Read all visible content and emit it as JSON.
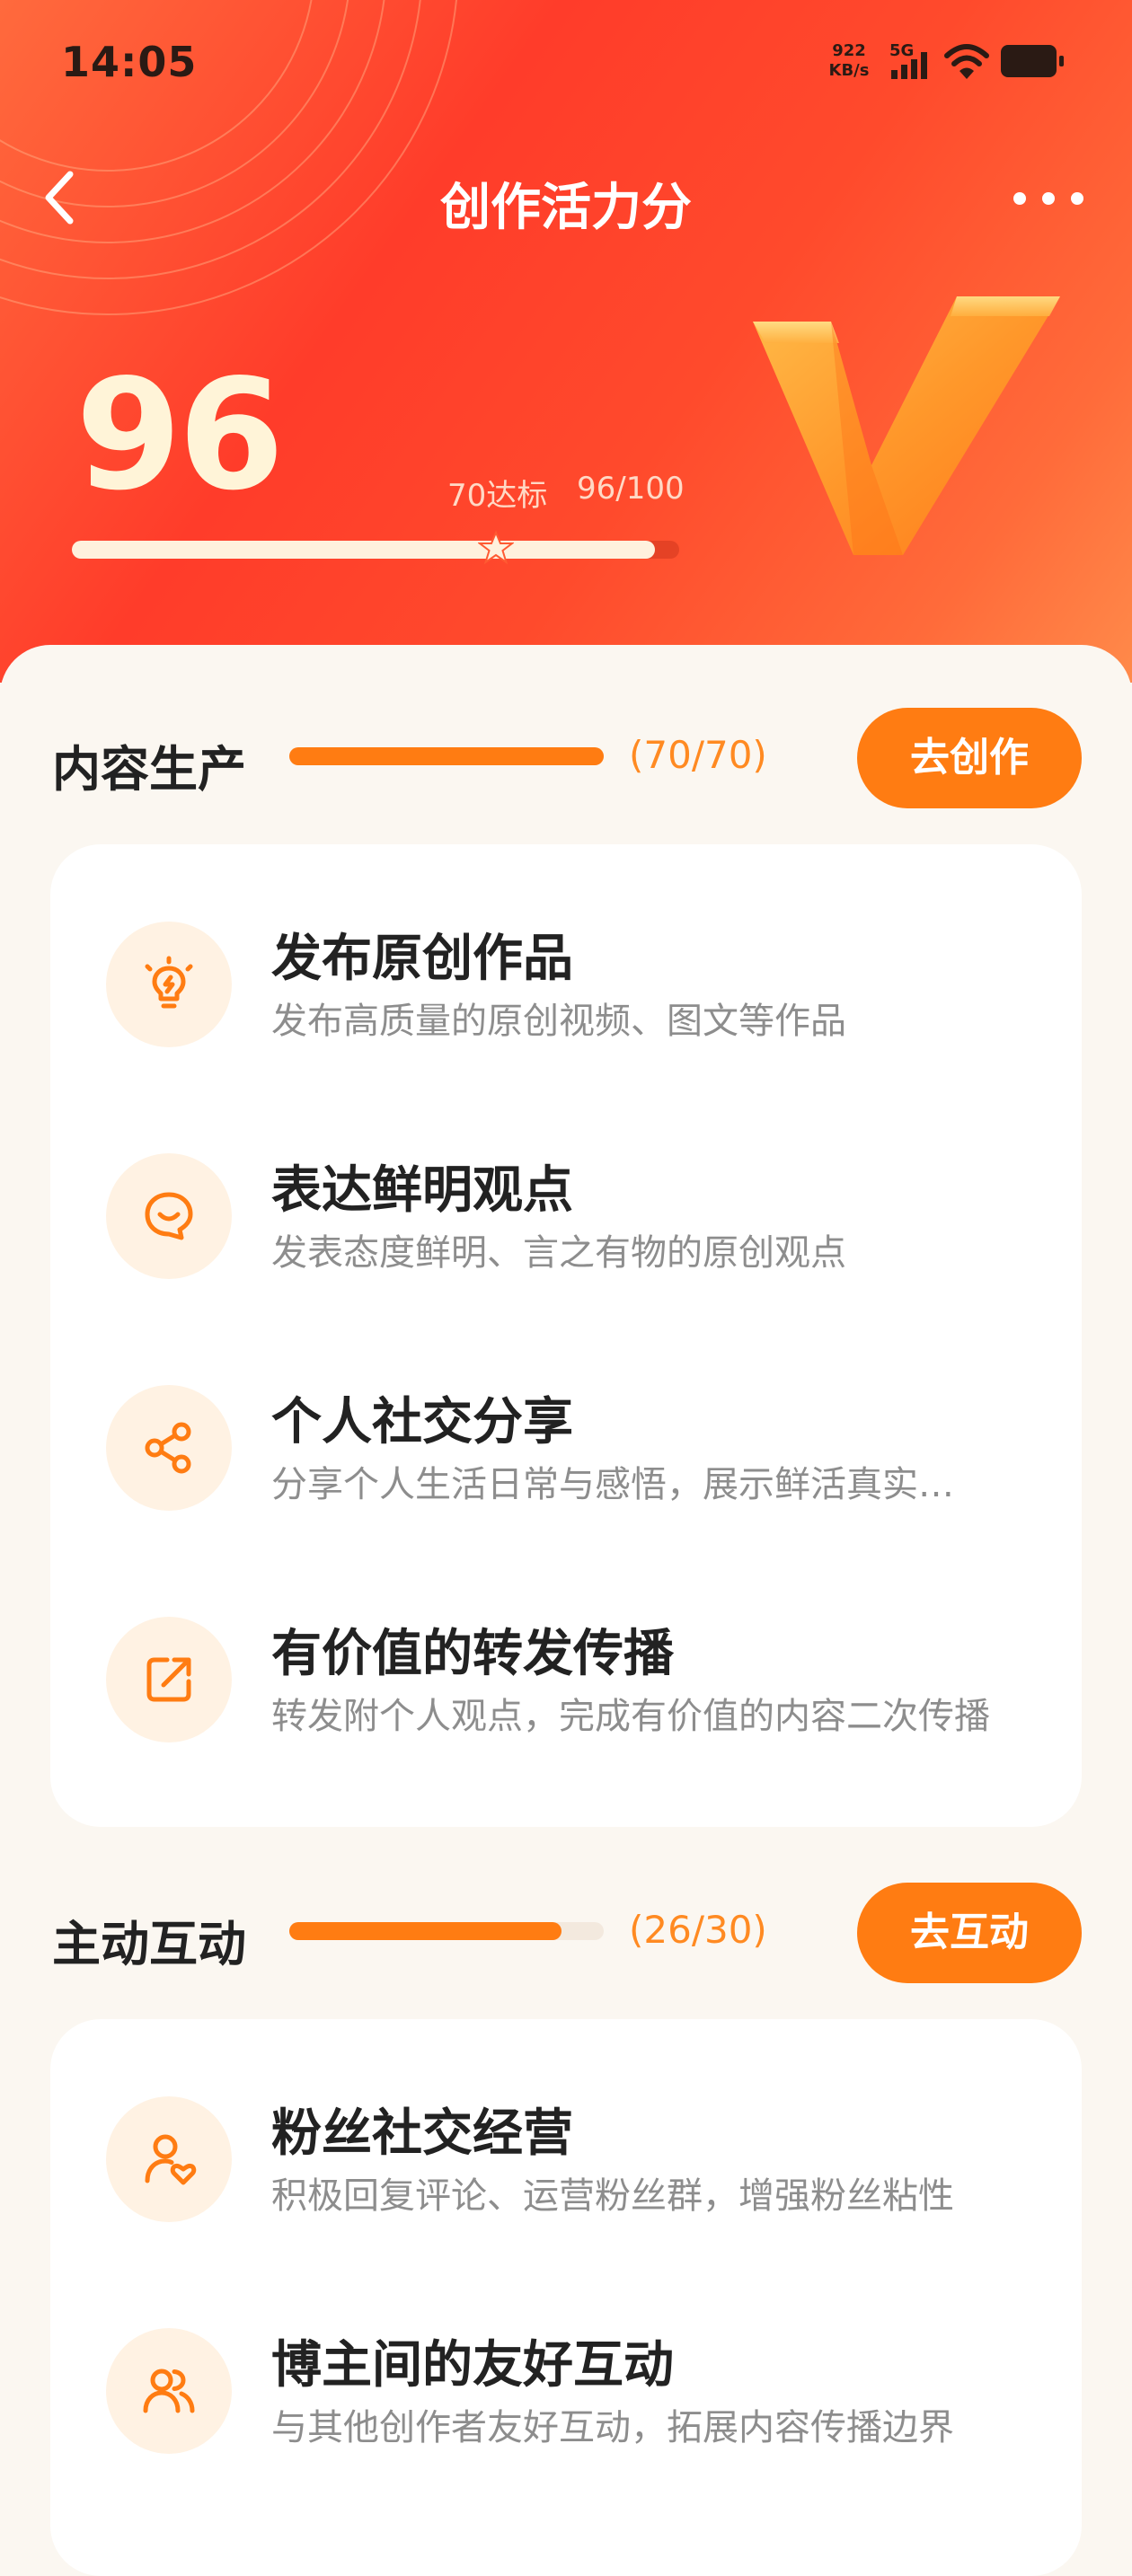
{
  "status_bar": {
    "time": "14:05",
    "speed_value": "922",
    "speed_unit": "KB/s",
    "network": "5G"
  },
  "nav": {
    "title": "创作活力分"
  },
  "score": {
    "value": "96",
    "threshold_label": "70达标",
    "ratio_label": "96/100",
    "fraction": 0.96
  },
  "colors": {
    "accent": "#FF7C12",
    "hero_red": "#FF3C2A",
    "score_text": "#FFF4D8"
  },
  "sections": [
    {
      "title": "内容生产",
      "count": "(70/70)",
      "progress": 1.0,
      "button": "去创作",
      "items": [
        {
          "icon": "lightbulb-icon",
          "title": "发布原创作品",
          "desc": "发布高质量的原创视频、图文等作品"
        },
        {
          "icon": "smile-chat-icon",
          "title": "表达鲜明观点",
          "desc": "发表态度鲜明、言之有物的原创观点"
        },
        {
          "icon": "share-icon",
          "title": "个人社交分享",
          "desc": "分享个人生活日常与感悟，展示鲜活真实…"
        },
        {
          "icon": "forward-icon",
          "title": "有价值的转发传播",
          "desc": "转发附个人观点，完成有价值的内容二次传播"
        }
      ]
    },
    {
      "title": "主动互动",
      "count": "(26/30)",
      "progress": 0.867,
      "button": "去互动",
      "items": [
        {
          "icon": "fan-heart-icon",
          "title": "粉丝社交经营",
          "desc": "积极回复评论、运营粉丝群，增强粉丝粘性"
        },
        {
          "icon": "users-icon",
          "title": "博主间的友好互动",
          "desc": "与其他创作者友好互动，拓展内容传播边界"
        }
      ]
    }
  ]
}
